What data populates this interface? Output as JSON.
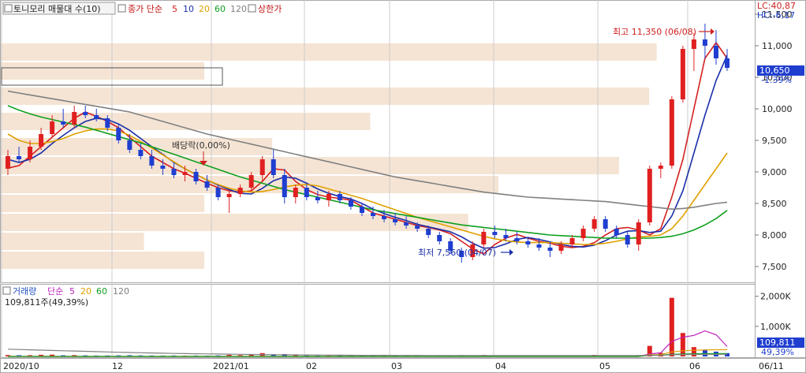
{
  "legend_price": {
    "box": "토니모리 매물대 수(10)",
    "close_label": "종가 단순",
    "ma_periods": [
      {
        "label": "5",
        "color": "#d42020"
      },
      {
        "label": "10",
        "color": "#1a2ea8"
      },
      {
        "label": "20",
        "color": "#e0a000"
      },
      {
        "label": "60",
        "color": "#10a020"
      },
      {
        "label": "120",
        "color": "#808080"
      }
    ],
    "limit_up": "상한가"
  },
  "legend_volume": {
    "title": "거래량",
    "ma_label": "단순",
    "ma_periods": [
      {
        "label": "5",
        "color": "#c020c0"
      },
      {
        "label": "20",
        "color": "#e0a000"
      },
      {
        "label": "60",
        "color": "#10a020"
      },
      {
        "label": "120",
        "color": "#808080"
      }
    ],
    "current": "109,811주(49,39%)"
  },
  "corner": {
    "lc": "LC:40,87",
    "hc": "HC:-6,17"
  },
  "price_badge": {
    "value": "10,650",
    "change": "-1.39%"
  },
  "volume_badge": {
    "value": "109,811",
    "pct": "49,39%"
  },
  "annotations": {
    "high": "최고 11,350 (06/08)",
    "low": "최저 7,560 (04/07)",
    "dividend": "배당락(0,00%)"
  },
  "colors": {
    "up": "#e02020",
    "down": "#1f3ed0",
    "profile": "#f5e4d4",
    "grid": "#cccccc"
  },
  "chart_data": {
    "type": "candlestick",
    "x_ticks": [
      "2020/10",
      "12",
      "2021/01",
      "02",
      "03",
      "04",
      "05",
      "06",
      "06/11"
    ],
    "price_axis": {
      "ticks": [
        "7,500",
        "8,000",
        "8,500",
        "9,000",
        "9,500",
        "10,000",
        "10,500",
        "11,000",
        "11,500"
      ],
      "range": [
        7300,
        11650
      ]
    },
    "volume_axis": {
      "ticks": [
        "1,000K",
        "2,000K"
      ],
      "range": [
        0,
        2150000
      ]
    },
    "volume_profile_levels": [
      7600,
      7900,
      8200,
      8500,
      8800,
      9100,
      9400,
      9800,
      10200,
      10600,
      10900
    ],
    "volume_profile_strength": [
      0.27,
      0.19,
      0.62,
      0.27,
      0.66,
      0.82,
      0.36,
      0.49,
      0.86,
      0.27,
      0.87
    ],
    "highlight_level": 10600,
    "series": [
      {
        "name": "5",
        "values": [
          9060,
          9100,
          9250,
          9400,
          9550,
          9700,
          9850,
          9950,
          9880,
          9800,
          9700,
          9550,
          9400,
          9250,
          9150,
          9050,
          8980,
          8900,
          8820,
          8750,
          8700,
          8680,
          8700,
          8850,
          9050,
          9030,
          8850,
          8720,
          8640,
          8600,
          8580,
          8550,
          8450,
          8350,
          8300,
          8250,
          8200,
          8150,
          8120,
          8080,
          8020,
          7900,
          7780,
          7700,
          7850,
          7950,
          8010,
          7950,
          7900,
          7870,
          7820,
          7800,
          7820,
          7880,
          8000,
          8100,
          8120,
          8080,
          8000,
          8100,
          8600,
          9200,
          10000,
          10800,
          11050,
          10800
        ]
      },
      {
        "name": "10",
        "values": [
          9200,
          9150,
          9200,
          9300,
          9450,
          9580,
          9700,
          9800,
          9850,
          9830,
          9760,
          9660,
          9530,
          9400,
          9280,
          9150,
          9050,
          8960,
          8870,
          8790,
          8720,
          8660,
          8650,
          8740,
          8860,
          8920,
          8900,
          8820,
          8730,
          8660,
          8610,
          8570,
          8500,
          8410,
          8340,
          8280,
          8230,
          8170,
          8130,
          8090,
          8050,
          7970,
          7870,
          7790,
          7800,
          7860,
          7930,
          7960,
          7930,
          7890,
          7850,
          7820,
          7810,
          7840,
          7910,
          8000,
          8060,
          8070,
          8040,
          8060,
          8300,
          8700,
          9300,
          9900,
          10450,
          10850
        ]
      },
      {
        "name": "20",
        "values": [
          9600,
          9500,
          9450,
          9450,
          9480,
          9530,
          9600,
          9650,
          9680,
          9680,
          9650,
          9580,
          9480,
          9380,
          9270,
          9160,
          9050,
          8960,
          8870,
          8800,
          8740,
          8700,
          8680,
          8690,
          8720,
          8760,
          8790,
          8800,
          8780,
          8730,
          8680,
          8630,
          8580,
          8520,
          8460,
          8400,
          8340,
          8280,
          8230,
          8180,
          8130,
          8080,
          8030,
          7980,
          7940,
          7910,
          7890,
          7880,
          7880,
          7880,
          7870,
          7860,
          7850,
          7850,
          7870,
          7900,
          7940,
          7970,
          7980,
          8000,
          8100,
          8300,
          8550,
          8800,
          9050,
          9300
        ]
      },
      {
        "name": "60",
        "values": [
          10050,
          9980,
          9920,
          9870,
          9830,
          9790,
          9750,
          9710,
          9660,
          9610,
          9560,
          9510,
          9460,
          9400,
          9340,
          9280,
          9220,
          9160,
          9100,
          9040,
          8980,
          8920,
          8870,
          8820,
          8770,
          8720,
          8680,
          8640,
          8600,
          8560,
          8520,
          8480,
          8440,
          8400,
          8370,
          8340,
          8310,
          8280,
          8250,
          8220,
          8190,
          8160,
          8140,
          8120,
          8100,
          8080,
          8060,
          8040,
          8020,
          8000,
          7990,
          7980,
          7970,
          7960,
          7950,
          7950,
          7950,
          7950,
          7950,
          7960,
          7980,
          8020,
          8080,
          8160,
          8260,
          8390
        ]
      },
      {
        "name": "120",
        "values": [
          10280,
          10250,
          10220,
          10190,
          10160,
          10130,
          10100,
          10070,
          10040,
          10010,
          9980,
          9950,
          9900,
          9850,
          9800,
          9750,
          9700,
          9650,
          9600,
          9560,
          9520,
          9480,
          9440,
          9400,
          9360,
          9320,
          9280,
          9240,
          9200,
          9160,
          9120,
          9080,
          9040,
          9000,
          8960,
          8920,
          8890,
          8860,
          8830,
          8800,
          8770,
          8740,
          8710,
          8680,
          8660,
          8640,
          8620,
          8600,
          8590,
          8580,
          8570,
          8560,
          8550,
          8540,
          8530,
          8510,
          8490,
          8470,
          8450,
          8430,
          8410,
          8420,
          8440,
          8470,
          8500,
          8520
        ]
      }
    ],
    "candles": [
      [
        9050,
        9350,
        8950,
        9250
      ],
      [
        9250,
        9400,
        9150,
        9200
      ],
      [
        9200,
        9500,
        9150,
        9400
      ],
      [
        9400,
        9700,
        9350,
        9600
      ],
      [
        9600,
        9900,
        9550,
        9800
      ],
      [
        9800,
        10000,
        9700,
        9750
      ],
      [
        9750,
        10050,
        9700,
        9950
      ],
      [
        9950,
        10050,
        9850,
        9900
      ],
      [
        9900,
        10000,
        9800,
        9850
      ],
      [
        9850,
        9900,
        9650,
        9700
      ],
      [
        9700,
        9750,
        9450,
        9500
      ],
      [
        9500,
        9600,
        9300,
        9350
      ],
      [
        9350,
        9450,
        9200,
        9250
      ],
      [
        9250,
        9350,
        9050,
        9100
      ],
      [
        9100,
        9200,
        8950,
        9050
      ],
      [
        9050,
        9150,
        8900,
        8950
      ],
      [
        8950,
        9100,
        8850,
        9000
      ],
      [
        9000,
        9050,
        8800,
        8850
      ],
      [
        8850,
        8950,
        8700,
        8750
      ],
      [
        8750,
        8800,
        8550,
        8600
      ],
      [
        8600,
        8700,
        8350,
        8650
      ],
      [
        8650,
        8800,
        8600,
        8750
      ],
      [
        8750,
        9000,
        8700,
        8950
      ],
      [
        8950,
        9250,
        8850,
        9200
      ],
      [
        9200,
        9350,
        8900,
        8950
      ],
      [
        8950,
        9050,
        8500,
        8600
      ],
      [
        8600,
        8800,
        8500,
        8750
      ],
      [
        8750,
        8800,
        8550,
        8600
      ],
      [
        8600,
        8700,
        8500,
        8550
      ],
      [
        8550,
        8700,
        8450,
        8650
      ],
      [
        8650,
        8700,
        8500,
        8550
      ],
      [
        8550,
        8600,
        8400,
        8450
      ],
      [
        8450,
        8500,
        8300,
        8350
      ],
      [
        8350,
        8450,
        8250,
        8300
      ],
      [
        8300,
        8400,
        8200,
        8250
      ],
      [
        8250,
        8350,
        8150,
        8200
      ],
      [
        8200,
        8300,
        8100,
        8150
      ],
      [
        8150,
        8200,
        8050,
        8100
      ],
      [
        8100,
        8150,
        7950,
        8000
      ],
      [
        8000,
        8050,
        7850,
        7900
      ],
      [
        7900,
        7950,
        7700,
        7750
      ],
      [
        7750,
        7800,
        7560,
        7650
      ],
      [
        7650,
        7900,
        7600,
        7850
      ],
      [
        7850,
        8100,
        7800,
        8050
      ],
      [
        8050,
        8150,
        7950,
        8000
      ],
      [
        8000,
        8100,
        7900,
        7950
      ],
      [
        7950,
        8050,
        7850,
        7900
      ],
      [
        7900,
        7950,
        7800,
        7850
      ],
      [
        7850,
        7950,
        7750,
        7800
      ],
      [
        7800,
        7900,
        7650,
        7750
      ],
      [
        7750,
        7900,
        7700,
        7850
      ],
      [
        7850,
        8000,
        7800,
        7950
      ],
      [
        7950,
        8150,
        7900,
        8100
      ],
      [
        8100,
        8300,
        8050,
        8250
      ],
      [
        8250,
        8300,
        8050,
        8100
      ],
      [
        8100,
        8150,
        7950,
        8000
      ],
      [
        8000,
        8050,
        7800,
        7850
      ],
      [
        7850,
        8250,
        7750,
        8200
      ],
      [
        8200,
        9100,
        8150,
        9050
      ],
      [
        9050,
        9150,
        8900,
        9100
      ],
      [
        9100,
        10200,
        9050,
        10150
      ],
      [
        10150,
        11000,
        10100,
        10950
      ],
      [
        10950,
        11200,
        10600,
        11100
      ],
      [
        11100,
        11350,
        10800,
        11000
      ],
      [
        11000,
        11250,
        10700,
        10800
      ],
      [
        10800,
        10950,
        10600,
        10650
      ]
    ],
    "volumes": [
      45000,
      40000,
      42000,
      55000,
      60000,
      38000,
      44000,
      35000,
      30000,
      32000,
      36000,
      40000,
      34000,
      30000,
      28000,
      31000,
      27000,
      29000,
      26000,
      33000,
      52000,
      45000,
      61000,
      110000,
      72000,
      78000,
      40000,
      33000,
      29000,
      31000,
      27000,
      25000,
      28000,
      24000,
      22000,
      26000,
      24000,
      21000,
      23000,
      25000,
      30000,
      42000,
      35000,
      48000,
      40000,
      30000,
      28000,
      26000,
      30000,
      34000,
      29000,
      32000,
      38000,
      50000,
      37000,
      31000,
      35000,
      44000,
      350000,
      120000,
      1950000,
      780000,
      310000,
      230000,
      160000,
      109811
    ],
    "volume_ma": [
      {
        "name": "5",
        "values": [
          0,
          0,
          0,
          0,
          0,
          0,
          0,
          0,
          0,
          0,
          0,
          0,
          0,
          0,
          0,
          0,
          0,
          0,
          0,
          0,
          0,
          0,
          0,
          0,
          0,
          0,
          0,
          0,
          0,
          0,
          0,
          0,
          0,
          0,
          0,
          0,
          0,
          0,
          0,
          0,
          0,
          0,
          0,
          0,
          0,
          0,
          0,
          0,
          0,
          0,
          0,
          0,
          0,
          0,
          0,
          0,
          0,
          0,
          80000,
          120000,
          500000,
          640000,
          700000,
          850000,
          720000,
          330000
        ]
      },
      {
        "name": "20",
        "values": [
          0,
          0,
          0,
          0,
          0,
          0,
          0,
          0,
          0,
          0,
          0,
          0,
          0,
          0,
          0,
          0,
          0,
          0,
          0,
          0,
          0,
          0,
          0,
          0,
          0,
          0,
          0,
          0,
          0,
          0,
          0,
          0,
          0,
          0,
          0,
          0,
          0,
          0,
          0,
          0,
          0,
          0,
          0,
          0,
          0,
          0,
          0,
          0,
          0,
          0,
          0,
          0,
          0,
          0,
          0,
          0,
          0,
          0,
          55000,
          60000,
          150000,
          190000,
          205000,
          215000,
          222000,
          226000
        ]
      },
      {
        "name": "60",
        "values": [
          0,
          0,
          0,
          0,
          0,
          0,
          0,
          0,
          0,
          0,
          0,
          0,
          0,
          0,
          0,
          0,
          0,
          0,
          0,
          0,
          0,
          0,
          0,
          0,
          0,
          0,
          0,
          0,
          0,
          0,
          0,
          0,
          0,
          0,
          0,
          0,
          0,
          0,
          0,
          0,
          0,
          0,
          0,
          0,
          0,
          0,
          0,
          0,
          0,
          0,
          0,
          0,
          0,
          0,
          0,
          0,
          0,
          0,
          40000,
          42000,
          72000,
          85000,
          90000,
          93000,
          95000,
          97000
        ]
      },
      {
        "name": "120",
        "values": [
          240000,
          230000,
          220000,
          210000,
          200000,
          190000,
          180000,
          170000,
          160000,
          150000,
          140000,
          132000,
          124000,
          116000,
          108000,
          100000,
          95000,
          90000,
          85000,
          80000,
          75000,
          70000,
          66000,
          62000,
          58000,
          55000,
          52000,
          49000,
          46000,
          44000,
          42000,
          40000,
          38000,
          37000,
          36000,
          35000,
          34000,
          33000,
          32000,
          32000,
          31000,
          31000,
          30000,
          30000,
          30000,
          30000,
          30000,
          30000,
          30000,
          30000,
          30000,
          30000,
          30000,
          30000,
          30000,
          30000,
          30000,
          30000,
          35000,
          37000,
          55000,
          62000,
          66000,
          68000,
          70000,
          72000
        ]
      }
    ]
  }
}
